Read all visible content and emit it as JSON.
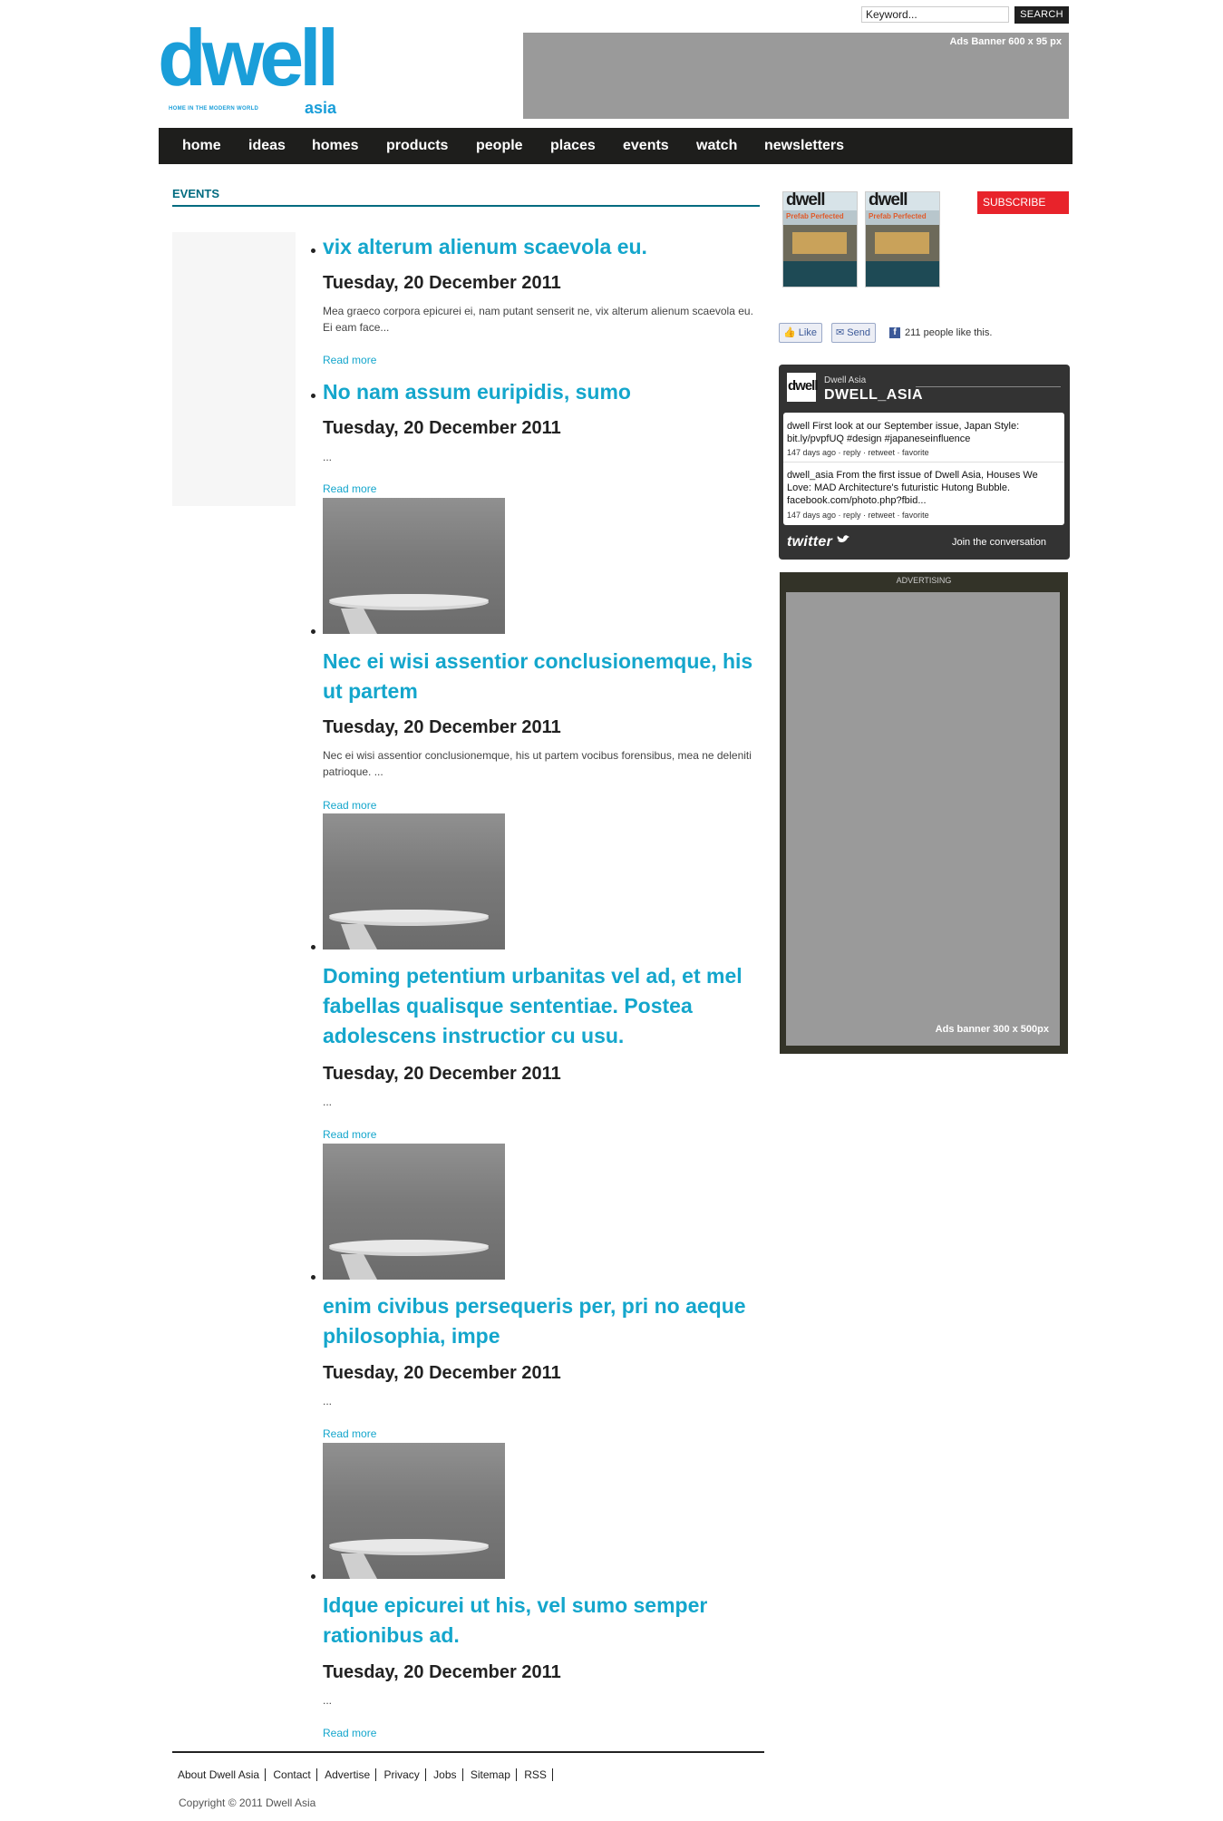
{
  "header": {
    "search_placeholder": "Keyword...",
    "search_button": "SEARCH",
    "logo_word": "dwell",
    "logo_sub": "asia",
    "logo_tagline": "HOME IN THE MODERN WORLD",
    "top_banner": "Ads Banner 600 x 95 px"
  },
  "nav": [
    {
      "label": "home"
    },
    {
      "label": "ideas"
    },
    {
      "label": "homes"
    },
    {
      "label": "products"
    },
    {
      "label": "people"
    },
    {
      "label": "places"
    },
    {
      "label": "events"
    },
    {
      "label": "watch"
    },
    {
      "label": "newsletters"
    }
  ],
  "main": {
    "section_title": "EVENTS",
    "read_more": "Read more",
    "posts": [
      {
        "title": "vix alterum alienum scaevola eu.",
        "date": "Tuesday, 20 December 2011",
        "excerpt": "Mea graeco corpora epicurei ei, nam putant senserit ne, vix alterum alienum scaevola eu. Ei eam face..."
      },
      {
        "title": "No nam assum euripidis, sumo",
        "date": "Tuesday, 20 December 2011",
        "excerpt": "..."
      },
      {
        "title": "Nec ei wisi assentior conclusionemque, his ut partem",
        "date": "Tuesday, 20 December 2011",
        "excerpt": "Nec ei wisi assentior conclusionemque, his ut partem vocibus forensibus, mea ne deleniti patrioque. ..."
      },
      {
        "title": "Doming petentium urbanitas vel ad, et mel fabellas qualisque sententiae. Postea adolescens instructior cu usu.",
        "date": "Tuesday, 20 December 2011",
        "excerpt": "..."
      },
      {
        "title": "enim civibus persequeris per, pri no aeque philosophia, impe",
        "date": "Tuesday, 20 December 2011",
        "excerpt": "..."
      },
      {
        "title": "Idque epicurei ut his, vel sumo semper rationibus ad.",
        "date": "Tuesday, 20 December 2011",
        "excerpt": "..."
      }
    ]
  },
  "footer": {
    "links": [
      "About Dwell Asia",
      "Contact",
      "Advertise",
      "Privacy",
      "Jobs",
      "Sitemap",
      "RSS"
    ],
    "copyright": "Copyright © 2011 Dwell Asia"
  },
  "sidebar": {
    "cover_logo": "dwell",
    "cover_headline": "Prefab Perfected",
    "subscribe": "SUBSCRIBE",
    "fb_like": "Like",
    "fb_send": "Send",
    "fb_count": "211 people like this.",
    "twitter": {
      "account_name": "Dwell Asia",
      "handle": "DWELL_ASIA",
      "tweets": [
        {
          "text": "dwell First look at our September issue, Japan Style: bit.ly/pvpfUQ #design #japaneseinfluence",
          "meta": "147 days ago · reply · retweet · favorite"
        },
        {
          "text": "dwell_asia From the first issue of Dwell Asia, Houses We Love: MAD Architecture's futuristic Hutong Bubble. facebook.com/photo.php?fbid...",
          "meta": "147 days ago · reply · retweet · favorite"
        }
      ],
      "brand": "twitter",
      "join": "Join the conversation"
    },
    "ad_label": "ADVERTISING",
    "ad_banner": "Ads banner 300 x 500px"
  },
  "colors": {
    "accent": "#14a6cc",
    "nav_bg": "#1e1e1c",
    "subscribe": "#e8232b",
    "section": "#006b80"
  }
}
